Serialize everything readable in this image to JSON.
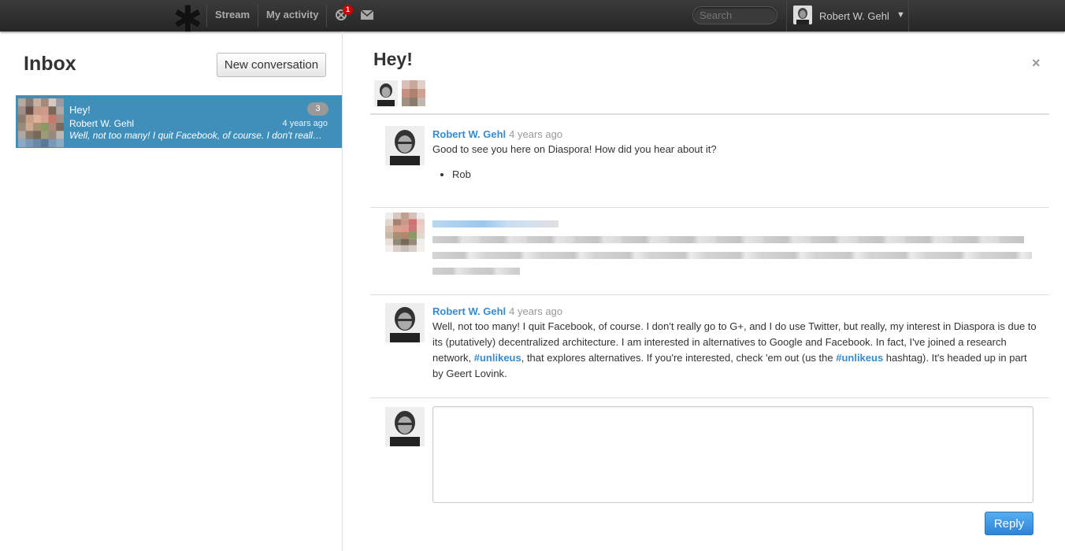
{
  "nav": {
    "stream": "Stream",
    "my_activity": "My activity",
    "notification_count": "1",
    "search_placeholder": "Search",
    "user_name": "Robert W. Gehl",
    "caret": "▼"
  },
  "inbox": {
    "title": "Inbox",
    "new_conversation": "New conversation",
    "conversations": [
      {
        "subject": "Hey!",
        "author": "Robert W. Gehl",
        "preview": "Well, not too many! I quit Facebook, of course. I don't really go to G+, and I do use Twitter, but really",
        "count": "3",
        "time": "4 years ago"
      }
    ]
  },
  "conversation": {
    "title": "Hey!",
    "close": "×",
    "messages": [
      {
        "author": "Robert W. Gehl",
        "time": "4 years ago",
        "text": "Good to see you here on Diaspora! How did you hear about it?",
        "list_item": "Rob"
      },
      {
        "author": "",
        "time": "",
        "text": "",
        "redacted": true
      },
      {
        "author": "Robert W. Gehl",
        "time": "4 years ago",
        "text_1": "Well, not too many! I quit Facebook, of course. I don't really go to G+, and I do use Twitter, but really, my interest in Diaspora is due to its (putatively) decentralized architecture. I am interested in alternatives to Google and Facebook. In fact, I've joined a research network, ",
        "tag_1": "#unlikeus",
        "text_2": ", that explores alternatives. If you're interested, check 'em out (us the ",
        "tag_2": "#unlikeus",
        "text_3": " hashtag). It's headed up in part by Geert Lovink."
      }
    ],
    "reply_label": "Reply"
  },
  "colors": {
    "topbar": "#2e2e2e",
    "selected_conversation": "#3f8fba",
    "link": "#3a8ac8",
    "reply_button": "#3d95e0"
  }
}
